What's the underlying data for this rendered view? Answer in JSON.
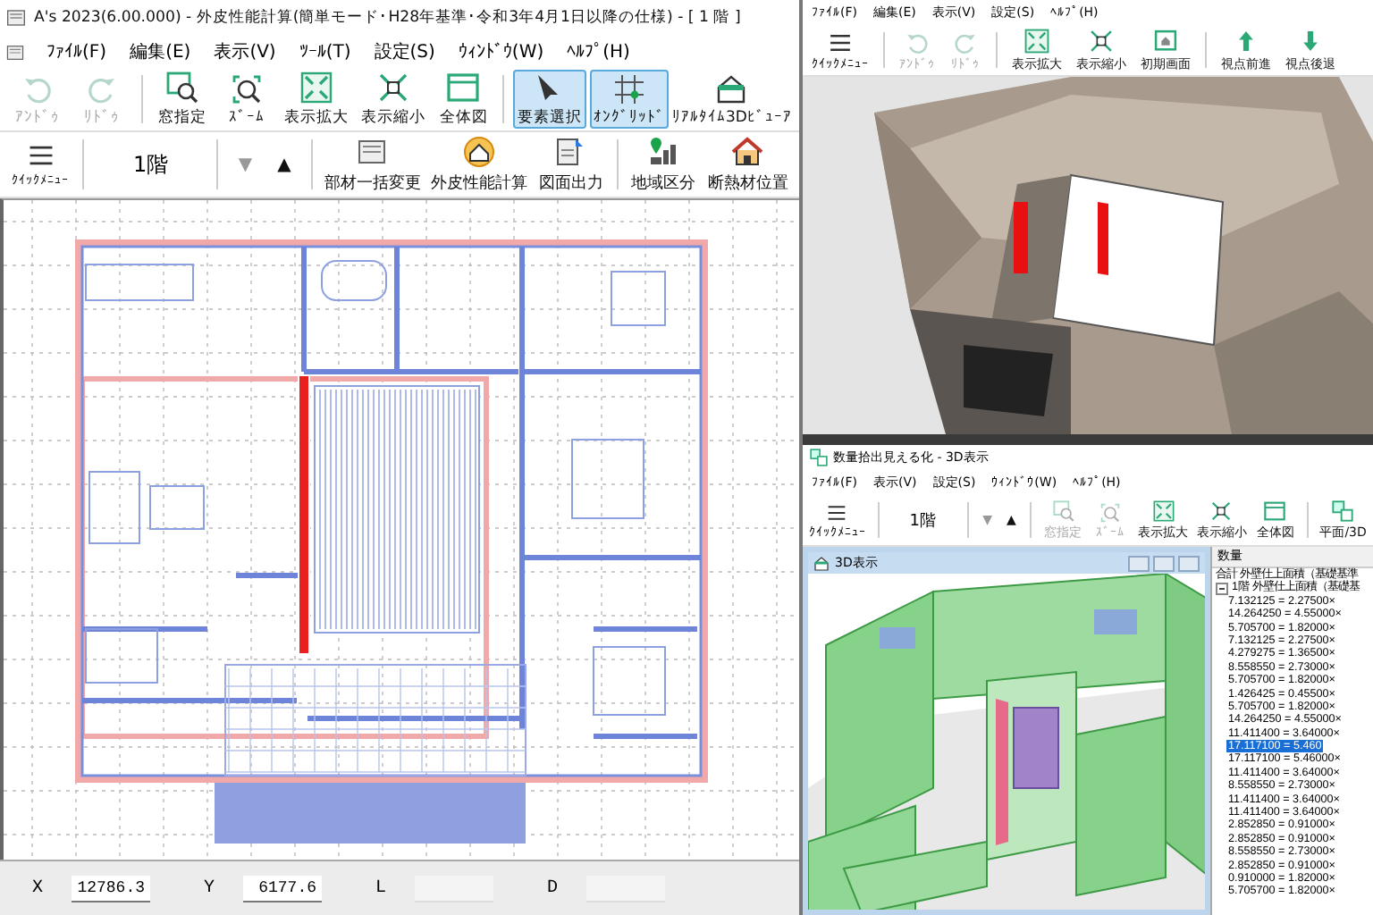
{
  "main_window": {
    "title": "A's 2023(6.00.000) - 外皮性能計算(簡単モード･H28年基準･令和3年4月1日以降の仕様) - [ 1 階 ]",
    "menu": [
      "ﾌｧｲﾙ(F)",
      "編集(E)",
      "表示(V)",
      "ﾂｰﾙ(T)",
      "設定(S)",
      "ｳｨﾝﾄﾞｳ(W)",
      "ﾍﾙﾌﾟ(H)"
    ],
    "toolbar": [
      {
        "label": "ｱﾝﾄﾞｩ",
        "disabled": true,
        "selected": false
      },
      {
        "label": "ﾘﾄﾞｩ",
        "disabled": true,
        "selected": false
      },
      {
        "label": "窓指定",
        "disabled": false,
        "selected": false
      },
      {
        "label": "ｽﾞｰﾑ",
        "disabled": false,
        "selected": false
      },
      {
        "label": "表示拡大",
        "disabled": false,
        "selected": false
      },
      {
        "label": "表示縮小",
        "disabled": false,
        "selected": false
      },
      {
        "label": "全体図",
        "disabled": false,
        "selected": false
      },
      {
        "label": "要素選択",
        "disabled": false,
        "selected": true
      },
      {
        "label": "ｵﾝｸﾞﾘｯﾄﾞ",
        "disabled": false,
        "selected": true
      },
      {
        "label": "ﾘｱﾙﾀｲﾑ3Dﾋﾞｭｰｱ",
        "disabled": false,
        "selected": false
      }
    ],
    "quick_menu": "ｸｲｯｸﾒﾆｭｰ",
    "floor": "1階",
    "floor_down": {
      "label": "▼",
      "disabled": true
    },
    "floor_up": {
      "label": "▲",
      "disabled": false
    },
    "toolbar_2": [
      "部材一括変更",
      "外皮性能計算",
      "図面出力",
      "地域区分",
      "断熱材位置"
    ],
    "status_bar": [
      {
        "label": "X",
        "value": "12786.3"
      },
      {
        "label": "Y",
        "value": "6177.6"
      },
      {
        "label": "L"
      },
      {
        "label": "D"
      }
    ]
  },
  "viewer_window": {
    "menu": [
      "ﾌｧｲﾙ(F)",
      "編集(E)",
      "表示(V)",
      "設定(S)",
      "ﾍﾙﾌﾟ(H)"
    ],
    "quick_menu": "ｸｲｯｸﾒﾆｭｰ",
    "toolbar": [
      {
        "label": "ｱﾝﾄﾞｩ",
        "disabled": true
      },
      {
        "label": "ﾘﾄﾞｩ",
        "disabled": true
      },
      {
        "label": "表示拡大",
        "disabled": false
      },
      {
        "label": "表示縮小",
        "disabled": false
      },
      {
        "label": "初期画面",
        "disabled": false
      },
      {
        "label": "視点前進",
        "disabled": false
      },
      {
        "label": "視点後退",
        "disabled": false
      }
    ]
  },
  "quantity_window": {
    "title": "数量拾出見える化 - 3D表示",
    "menu": [
      "ﾌｧｲﾙ(F)",
      "表示(V)",
      "設定(S)",
      "ｳｨﾝﾄﾞｳ(W)",
      "ﾍﾙﾌﾟ(H)"
    ],
    "quick_menu": "ｸｲｯｸﾒﾆｭｰ",
    "floor": "1階",
    "floor_down": {
      "label": "▼",
      "disabled": true
    },
    "floor_up": {
      "label": "▲",
      "disabled": false
    },
    "toolbar": [
      {
        "label": "窓指定",
        "disabled": true
      },
      {
        "label": "ｽﾞｰﾑ",
        "disabled": true
      },
      {
        "label": "表示拡大",
        "disabled": false
      },
      {
        "label": "表示縮小",
        "disabled": false
      },
      {
        "label": "全体図",
        "disabled": false
      },
      {
        "label": "平面/3D",
        "disabled": false
      }
    ],
    "view_title": "3D表示",
    "list_heading": "数量",
    "tree": [
      {
        "label": "合計 外壁仕上面積（基礎基準",
        "selected": false,
        "children": [
          {
            "label": "1階 外壁仕上面積（基礎基",
            "selected": false,
            "expanded": true,
            "children": [
              {
                "label": "7.132125 = 2.27500×",
                "selected": false
              },
              {
                "label": "14.264250 = 4.55000×",
                "selected": false
              },
              {
                "label": "5.705700 = 1.82000×",
                "selected": false
              },
              {
                "label": "7.132125 = 2.27500×",
                "selected": false
              },
              {
                "label": "4.279275 = 1.36500×",
                "selected": false
              },
              {
                "label": "8.558550 = 2.73000×",
                "selected": false
              },
              {
                "label": "5.705700 = 1.82000×",
                "selected": false
              },
              {
                "label": "1.426425 = 0.45500×",
                "selected": false
              },
              {
                "label": "5.705700 = 1.82000×",
                "selected": false
              },
              {
                "label": "14.264250 = 4.55000×",
                "selected": false
              },
              {
                "label": "11.411400 = 3.64000×",
                "selected": false
              },
              {
                "label": "17.117100 = 5.460",
                "selected": true
              },
              {
                "label": "17.117100 = 5.46000×",
                "selected": false
              },
              {
                "label": "11.411400 = 3.64000×",
                "selected": false
              },
              {
                "label": "8.558550 = 2.73000×",
                "selected": false
              },
              {
                "label": "11.411400 = 3.64000×",
                "selected": false
              },
              {
                "label": "11.411400 = 3.64000×",
                "selected": false
              },
              {
                "label": "2.852850 = 0.91000×",
                "selected": false
              },
              {
                "label": "2.852850 = 0.91000×",
                "selected": false
              },
              {
                "label": "8.558550 = 2.73000×",
                "selected": false
              },
              {
                "label": "2.852850 = 0.91000×",
                "selected": false
              },
              {
                "label": "0.910000 = 1.82000×",
                "selected": false
              },
              {
                "label": "5.705700 = 1.82000×",
                "selected": false
              }
            ]
          }
        ]
      }
    ]
  }
}
